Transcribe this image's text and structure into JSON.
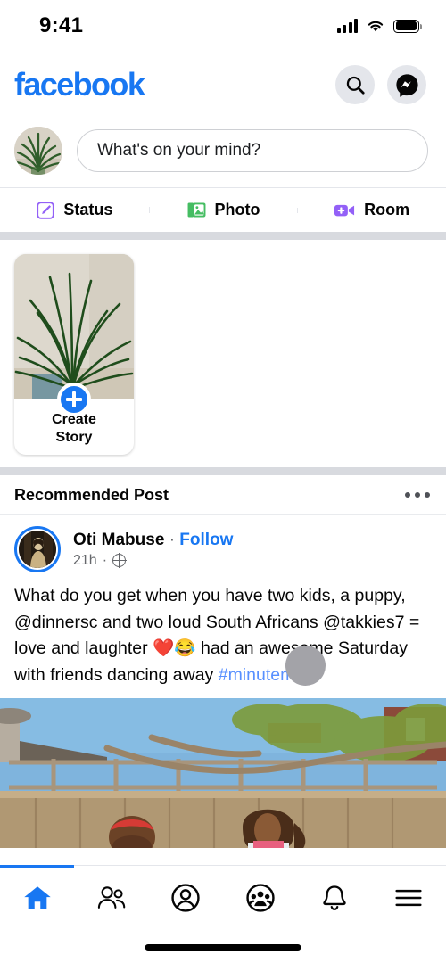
{
  "status_bar": {
    "time": "9:41",
    "signal_icon": "cellular-bars-icon",
    "wifi_icon": "wifi-icon",
    "battery_icon": "battery-full-icon"
  },
  "header": {
    "logo_text": "facebook",
    "logo_color": "#1877F2",
    "search_icon": "search-icon",
    "messenger_icon": "messenger-icon"
  },
  "composer": {
    "avatar_alt": "plant-profile-photo",
    "placeholder": "What's on your mind?",
    "actions": [
      {
        "label": "Status",
        "icon": "status-pencil-icon",
        "color": "#9360F7"
      },
      {
        "label": "Photo",
        "icon": "photo-icon",
        "color": "#45BD62"
      },
      {
        "label": "Room",
        "icon": "room-video-icon",
        "color": "#9360F7"
      }
    ]
  },
  "stories": {
    "create_story": {
      "line1": "Create",
      "line2": "Story",
      "plus_icon": "plus-icon",
      "plus_color": "#1877F2"
    },
    "placeholder_alt": "loading-story-placeholder"
  },
  "recommended": {
    "title": "Recommended Post",
    "menu_icon": "more-options-icon"
  },
  "post": {
    "author": "Oti  Mabuse",
    "separator": "·",
    "follow_label": "Follow",
    "timestamp": "21h",
    "time_separator": "·",
    "audience_icon": "globe-public-icon",
    "text_part1": "What do you get when you have two kids, a puppy, @dinnersc and two loud South Africans @takkies7 = love and laughter ",
    "emoji": "❤️😂",
    "text_part2": " had an awesome Saturday with friends dancing away ",
    "hashtag": "#minuteman",
    "media_alt": "garden-video-children-fence"
  },
  "bottom_nav": {
    "items": [
      {
        "name": "home",
        "icon": "home-icon",
        "active": true
      },
      {
        "name": "friends",
        "icon": "friends-icon",
        "active": false
      },
      {
        "name": "profile",
        "icon": "profile-icon",
        "active": false
      },
      {
        "name": "groups",
        "icon": "groups-icon",
        "active": false
      },
      {
        "name": "notifications",
        "icon": "bell-icon",
        "active": false
      },
      {
        "name": "menu",
        "icon": "hamburger-menu-icon",
        "active": false
      }
    ],
    "active_color": "#1877F2",
    "home_indicator": "home-indicator-bar"
  }
}
